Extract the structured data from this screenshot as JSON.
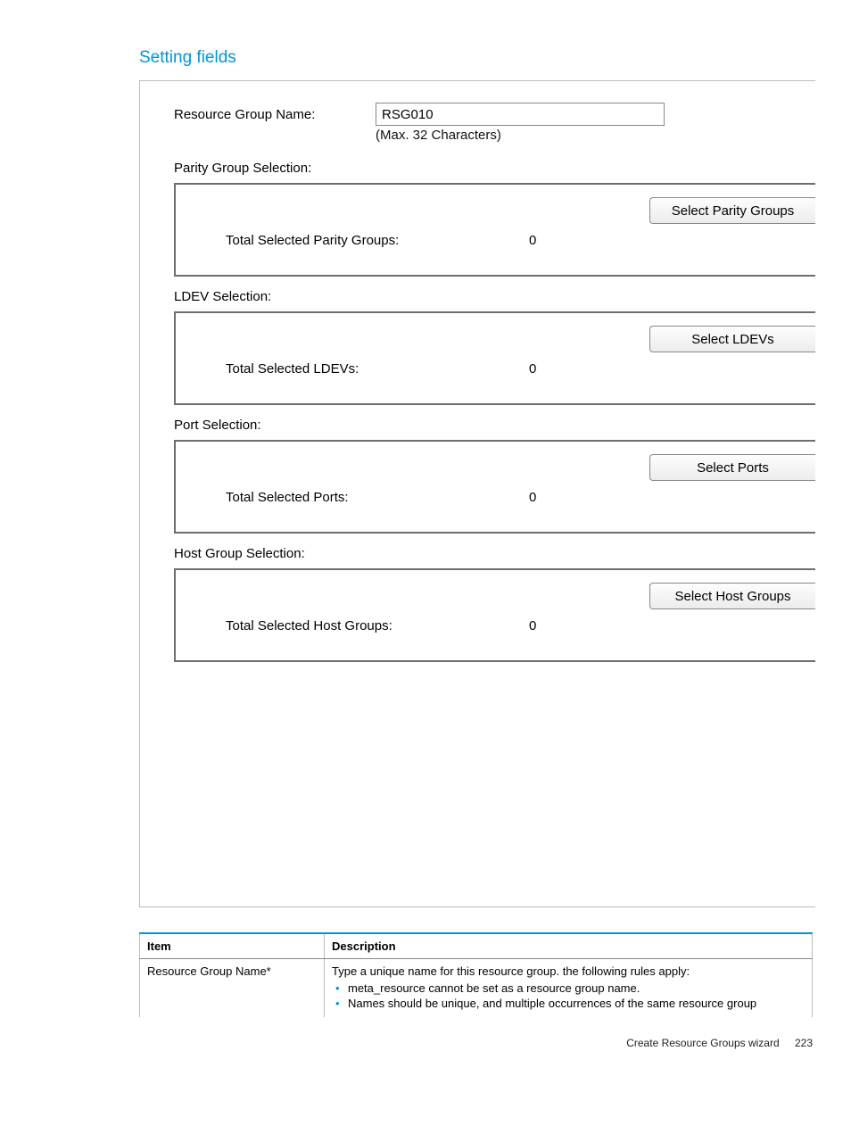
{
  "section_title": "Setting fields",
  "form": {
    "rg_name_label": "Resource Group Name:",
    "rg_name_value": "RSG010",
    "rg_name_hint": "(Max. 32 Characters)",
    "groups": {
      "parity": {
        "label": "Parity Group Selection:",
        "button": "Select Parity Groups",
        "count_label": "Total Selected Parity Groups:",
        "count": "0"
      },
      "ldev": {
        "label": "LDEV Selection:",
        "button": "Select LDEVs",
        "count_label": "Total Selected LDEVs:",
        "count": "0"
      },
      "port": {
        "label": "Port Selection:",
        "button": "Select Ports",
        "count_label": "Total Selected Ports:",
        "count": "0"
      },
      "host": {
        "label": "Host Group Selection:",
        "button": "Select Host Groups",
        "count_label": "Total Selected Host Groups:",
        "count": "0"
      }
    }
  },
  "table": {
    "header_item": "Item",
    "header_desc": "Description",
    "row_item": "Resource Group Name*",
    "row_desc_intro": "Type a unique name for this resource group. the following rules apply:",
    "row_desc_b1": "meta_resource cannot be set as a resource group name.",
    "row_desc_b2": "Names should be unique, and multiple occurrences of the same resource group"
  },
  "footer": {
    "text": "Create Resource Groups wizard",
    "page": "223"
  }
}
